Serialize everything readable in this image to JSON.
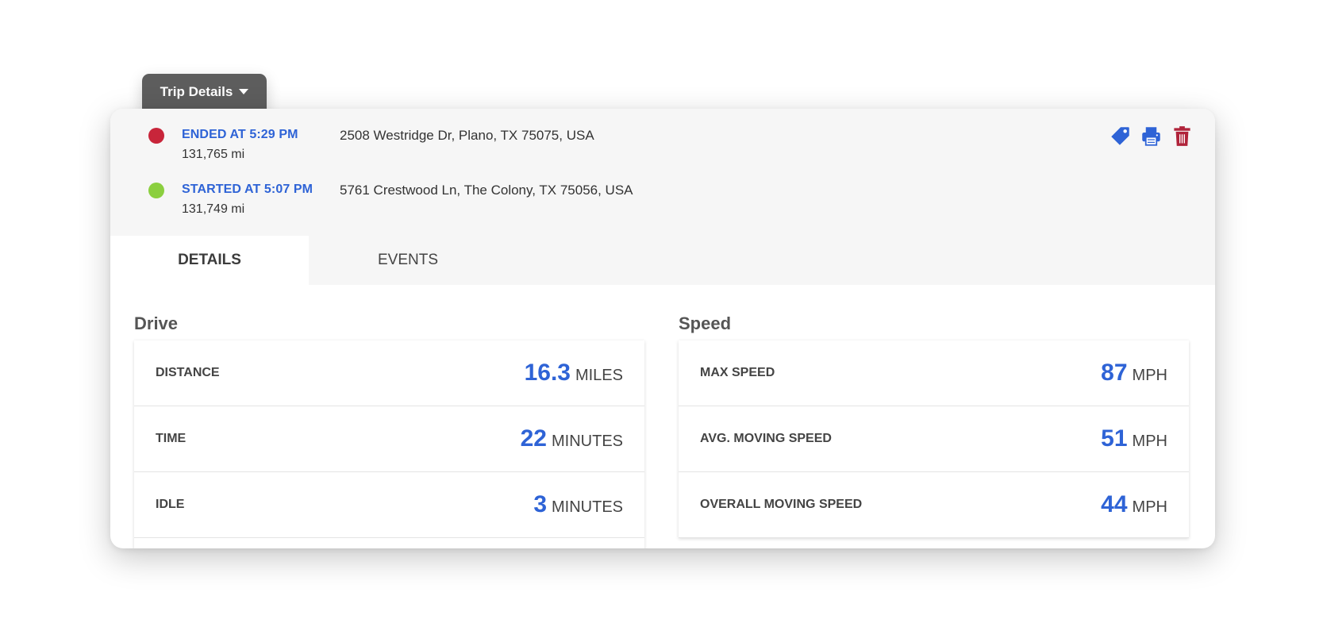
{
  "dropdown": {
    "label": "Trip Details"
  },
  "trip": {
    "end": {
      "label": "ENDED AT 5:29 PM",
      "odometer": "131,765 mi",
      "address": "2508 Westridge Dr, Plano, TX 75075, USA",
      "dot_color": "#c8253a"
    },
    "start": {
      "label": "STARTED AT 5:07 PM",
      "odometer": "131,749 mi",
      "address": "5761 Crestwood Ln, The Colony, TX 75056, USA",
      "dot_color": "#8bcf3f"
    }
  },
  "actions": [
    {
      "name": "tag-icon",
      "color": "#2e63d6"
    },
    {
      "name": "print-icon",
      "color": "#2e63d6"
    },
    {
      "name": "trash-icon",
      "color": "#b0233a"
    }
  ],
  "tabs": [
    {
      "label": "DETAILS",
      "active": true
    },
    {
      "label": "EVENTS",
      "active": false
    }
  ],
  "drive": {
    "title": "Drive",
    "rows": [
      {
        "label": "DISTANCE",
        "value": "16.3",
        "unit": "MILES"
      },
      {
        "label": "TIME",
        "value": "22",
        "unit": "MINUTES"
      },
      {
        "label": "IDLE",
        "value": "3",
        "unit": "MINUTES"
      }
    ]
  },
  "speed": {
    "title": "Speed",
    "rows": [
      {
        "label": "MAX SPEED",
        "value": "87",
        "unit": "MPH"
      },
      {
        "label": "AVG. MOVING SPEED",
        "value": "51",
        "unit": "MPH"
      },
      {
        "label": "OVERALL MOVING SPEED",
        "value": "44",
        "unit": "MPH"
      }
    ]
  },
  "colors": {
    "accent": "#2e63d6",
    "header_bg": "#f6f6f6",
    "dropdown_bg": "#5d5d5d"
  }
}
